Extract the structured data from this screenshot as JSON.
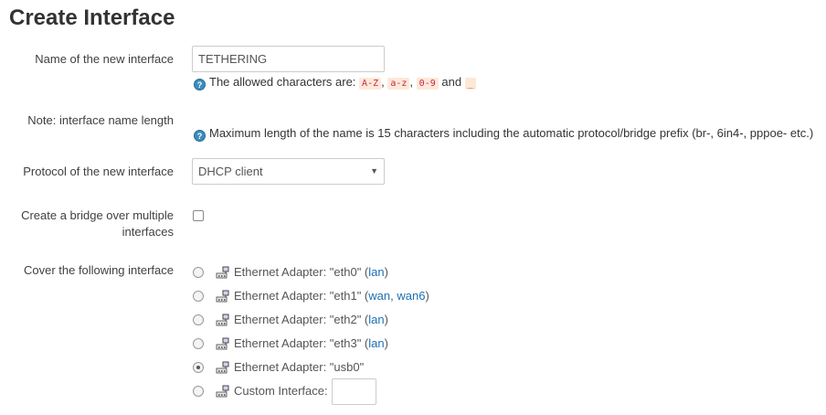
{
  "page_title": "Create Interface",
  "fields": {
    "name": {
      "label": "Name of the new interface",
      "value": "TETHERING",
      "help_prefix": "The allowed characters are:",
      "codes": [
        "A-Z",
        "a-z",
        "0-9",
        "_"
      ],
      "sep1": ",",
      "sep2": ",",
      "and": "and"
    },
    "note": {
      "label": "Note: interface name length",
      "help": "Maximum length of the name is 15 characters including the automatic protocol/bridge prefix (br-, 6in4-, pppoe- etc.)"
    },
    "protocol": {
      "label": "Protocol of the new interface",
      "selected": "DHCP client",
      "arrow": "▼"
    },
    "bridge": {
      "label_line1": "Create a bridge over multiple",
      "label_line2": "interfaces",
      "checked": false
    },
    "cover": {
      "label": "Cover the following interface",
      "options": [
        {
          "prefix": "Ethernet Adapter: \"eth0\" (",
          "links": [
            "lan"
          ],
          "suffix": ")",
          "checked": false
        },
        {
          "prefix": "Ethernet Adapter: \"eth1\" (",
          "links": [
            "wan",
            "wan6"
          ],
          "suffix": ")",
          "checked": false
        },
        {
          "prefix": "Ethernet Adapter: \"eth2\" (",
          "links": [
            "lan"
          ],
          "suffix": ")",
          "checked": false
        },
        {
          "prefix": "Ethernet Adapter: \"eth3\" (",
          "links": [
            "lan"
          ],
          "suffix": ")",
          "checked": false
        },
        {
          "prefix": "Ethernet Adapter: \"usb0\"",
          "links": [],
          "suffix": "",
          "checked": true
        },
        {
          "prefix": "Custom Interface:",
          "links": [],
          "suffix": "",
          "checked": false,
          "custom_value": ""
        }
      ],
      "link_separator": ", "
    }
  },
  "icons": {
    "help": "help-icon",
    "adapter": "ethernet-adapter-icon"
  },
  "colors": {
    "link": "#1e6fb6",
    "help_icon": "#3c8dbc",
    "code_bg": "#fde8d8"
  }
}
